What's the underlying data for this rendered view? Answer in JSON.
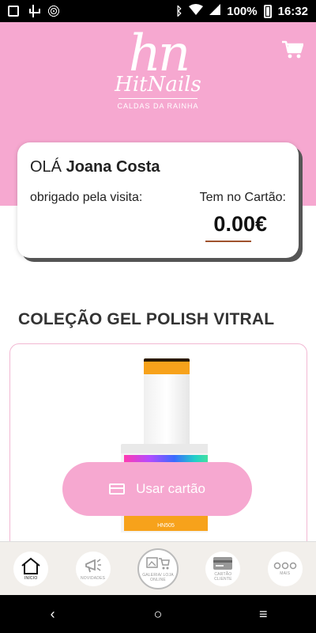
{
  "status_bar": {
    "battery": "100%",
    "time": "16:32"
  },
  "brand": {
    "mark": "hn",
    "name": "HitNails",
    "location": "CALDAS DA RAINHA"
  },
  "greeting": {
    "prefix": "OLÁ",
    "user_name": "Joana Costa",
    "thanks": "obrigado pela visita:",
    "card_label": "Tem no Cartão:",
    "balance": "0.00€"
  },
  "section": {
    "title": "COLEÇÃO GEL POLISH VITRAL"
  },
  "product": {
    "code": "HN505"
  },
  "use_card_button": {
    "label": "Usar cartão"
  },
  "bottom_nav": {
    "items": [
      {
        "label": "INÍCIO",
        "icon": "home-icon"
      },
      {
        "label": "NOVIDADES",
        "icon": "megaphone-icon"
      },
      {
        "label": "GALERIA/ LOJA ONLINE",
        "icon": "gallery-cart-icon"
      },
      {
        "label": "CARTÃO CLIENTE",
        "icon": "loyalty-card-icon"
      },
      {
        "label": "MAIS",
        "icon": "more-icon"
      }
    ]
  },
  "system_nav": {
    "back": "‹",
    "home": "○",
    "recents": "≡"
  },
  "colors": {
    "brand_pink": "#f6a8d0",
    "bottle_orange": "#f7a21b",
    "underline": "#a0522d"
  }
}
